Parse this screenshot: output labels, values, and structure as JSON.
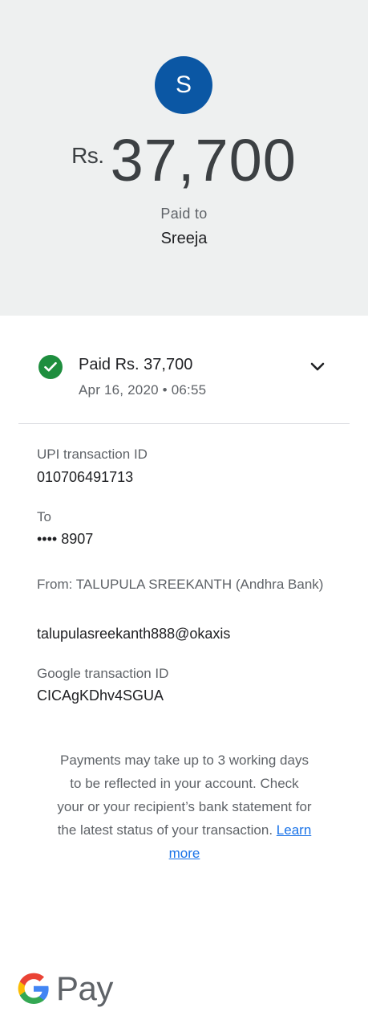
{
  "hero": {
    "avatar_initial": "S",
    "currency": "Rs.",
    "amount": "37,700",
    "paid_to_label": "Paid to",
    "payee_name": "Sreeja"
  },
  "status": {
    "title": "Paid Rs. 37,700",
    "date_time": "Apr 16, 2020 • 06:55",
    "icon": "check-circle-icon",
    "color": "#1e8e3e"
  },
  "details": {
    "upi_label": "UPI transaction ID",
    "upi_value": "010706491713",
    "to_label": "To",
    "to_value": "•••• 8907",
    "from_label": "From: TALUPULA SREEKANTH (Andhra Bank)",
    "from_value": "talupulasreekanth888@okaxis",
    "google_txn_label": "Google transaction ID",
    "google_txn_value": "CICAgKDhv4SGUA"
  },
  "notice": {
    "text": "Payments may take up to 3 working days to be reflected in your account. Check your or your recipient’s bank statement for the latest status of your transaction. ",
    "link": "Learn more"
  },
  "footer": {
    "brand_text": "Pay"
  },
  "colors": {
    "avatar": "#0b57a4",
    "hero_bg": "#eef0f0",
    "link": "#1a73e8"
  }
}
